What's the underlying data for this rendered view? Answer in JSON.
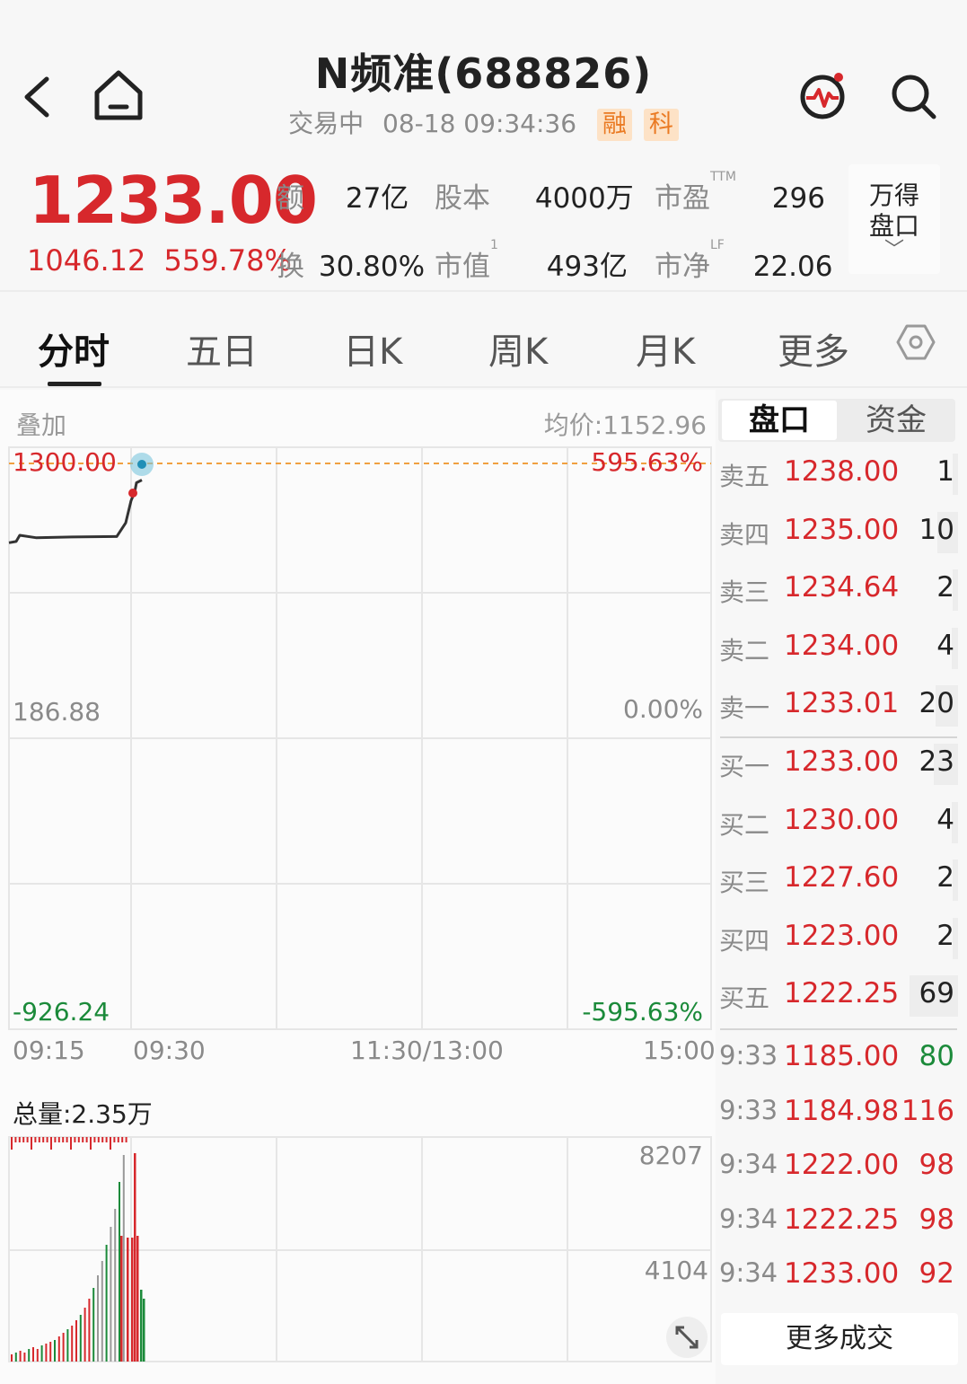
{
  "header": {
    "title": "N频准(688826)",
    "status": "交易中",
    "datetime": "08-18 09:34:36",
    "tags": [
      "融",
      "科"
    ]
  },
  "quote": {
    "price": "1233.00",
    "change": "1046.12",
    "change_pct": "559.78%",
    "stats": [
      {
        "label": "额",
        "sup": "",
        "value": "27亿"
      },
      {
        "label": "股本",
        "sup": "",
        "value": "4000万"
      },
      {
        "label": "市盈",
        "sup": "TTM",
        "value": "296"
      },
      {
        "label": "换",
        "sup": "",
        "value": "30.80%"
      },
      {
        "label": "市值",
        "sup": "1",
        "value": "493亿"
      },
      {
        "label": "市净",
        "sup": "LF",
        "value": "22.06"
      }
    ],
    "wind_button": [
      "万得",
      "盘口"
    ]
  },
  "tabs": [
    "分时",
    "五日",
    "日K",
    "周K",
    "月K",
    "更多"
  ],
  "chart": {
    "overlay_label": "叠加",
    "avg_price": "均价:1152.96",
    "y_top": "1300.00",
    "y_mid": "186.88",
    "y_bottom": "-926.24",
    "pct_top": "595.63%",
    "pct_mid": "0.00%",
    "pct_bottom": "-595.63%",
    "times": [
      "09:15",
      "09:30",
      "11:30/13:00",
      "15:00"
    ],
    "volume_total": "总量:2.35万",
    "vol_top": "8207",
    "vol_mid": "4104"
  },
  "chart_data": {
    "type": "line",
    "title": "",
    "ylim": [
      -926.24,
      1300.0
    ],
    "series": [
      {
        "x": [
          "09:15",
          "09:17",
          "09:20",
          "09:25",
          "09:29",
          "09:30",
          "09:31",
          "09:32",
          "09:33",
          "09:34"
        ],
        "values": [
          980,
          1010,
          1000,
          1003,
          1005,
          1060,
          1150,
          1185,
          1222,
          1233
        ]
      }
    ]
  },
  "order_book": {
    "tabs": [
      "盘口",
      "资金"
    ],
    "sells": [
      {
        "label": "卖五",
        "price": "1238.00",
        "qty": "1",
        "bar": 0.04
      },
      {
        "label": "卖四",
        "price": "1235.00",
        "qty": "10",
        "bar": 0.25
      },
      {
        "label": "卖三",
        "price": "1234.64",
        "qty": "2",
        "bar": 0.05
      },
      {
        "label": "卖二",
        "price": "1234.00",
        "qty": "4",
        "bar": 0.08
      },
      {
        "label": "卖一",
        "price": "1233.01",
        "qty": "20",
        "bar": 0.28
      }
    ],
    "buys": [
      {
        "label": "买一",
        "price": "1233.00",
        "qty": "23",
        "bar": 0.3
      },
      {
        "label": "买二",
        "price": "1230.00",
        "qty": "4",
        "bar": 0.08
      },
      {
        "label": "买三",
        "price": "1227.60",
        "qty": "2",
        "bar": 0.05
      },
      {
        "label": "买四",
        "price": "1223.00",
        "qty": "2",
        "bar": 0.05
      },
      {
        "label": "买五",
        "price": "1222.25",
        "qty": "69",
        "bar": 0.6
      }
    ],
    "trades": [
      {
        "time": "9:33",
        "price": "1185.00",
        "qty": "80",
        "side": "sell"
      },
      {
        "time": "9:33",
        "price": "1184.98",
        "qty": "116",
        "side": "buy"
      },
      {
        "time": "9:34",
        "price": "1222.00",
        "qty": "98",
        "side": "buy"
      },
      {
        "time": "9:34",
        "price": "1222.25",
        "qty": "98",
        "side": "buy"
      },
      {
        "time": "9:34",
        "price": "1233.00",
        "qty": "92",
        "side": "buy"
      }
    ],
    "more_trades": "更多成交"
  }
}
